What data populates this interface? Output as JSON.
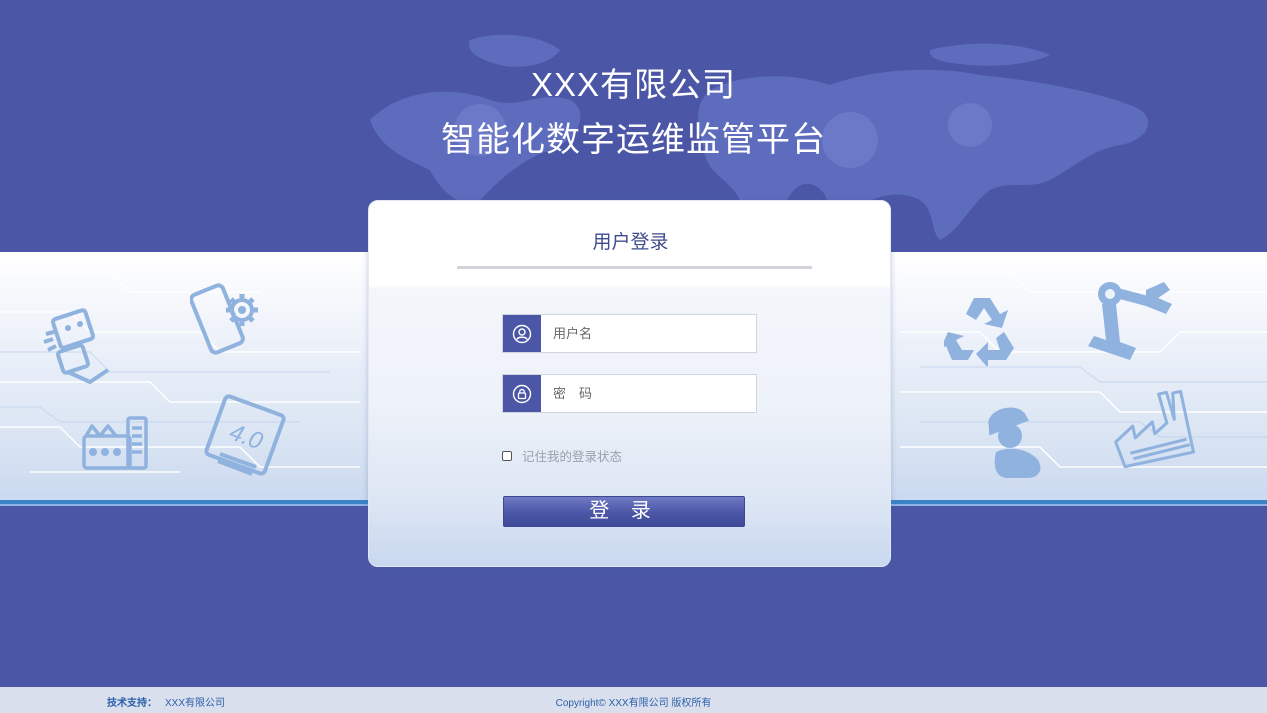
{
  "header": {
    "company": "XXX有限公司",
    "platform": "智能化数字运维监管平台"
  },
  "login": {
    "title": "用户登录",
    "username_placeholder": "用户名",
    "password_placeholder": "密　码",
    "remember_label": "记住我的登录状态",
    "remember_checked": false,
    "submit_label": "登 录"
  },
  "footer": {
    "support_label": "技术支持：",
    "support_value": "XXX有限公司",
    "copyright": "Copyright© XXX有限公司 版权所有"
  },
  "colors": {
    "background": "#4b56a7",
    "accent": "#4b56a7",
    "icon": "#8fb2de",
    "footer_text": "#2b5fa8"
  },
  "icons": [
    "robot-icon",
    "tablet-gear-icon",
    "machine-icon",
    "industry-4-icon",
    "recycle-icon",
    "robot-arm-icon",
    "worker-icon",
    "factory-icon",
    "user-icon",
    "lock-icon"
  ]
}
